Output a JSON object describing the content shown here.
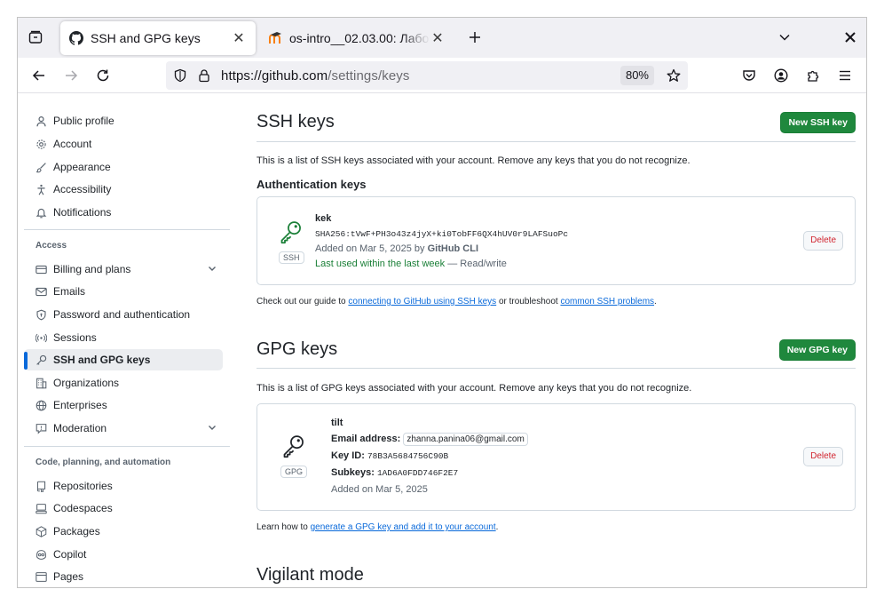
{
  "browser": {
    "tabs": [
      {
        "title": "SSH and GPG keys",
        "favicon": "github-icon",
        "active": true
      },
      {
        "title": "os-intro__02.03.00: Лабо",
        "favicon": "moodle-icon",
        "active": false
      }
    ],
    "url_host": "https://github.com",
    "url_path": "/settings/keys",
    "zoom": "80%"
  },
  "sidebar": {
    "items_top": [
      {
        "label": "Public profile",
        "icon": "person-icon"
      },
      {
        "label": "Account",
        "icon": "gear-icon"
      },
      {
        "label": "Appearance",
        "icon": "paintbrush-icon"
      },
      {
        "label": "Accessibility",
        "icon": "accessibility-icon"
      },
      {
        "label": "Notifications",
        "icon": "bell-icon"
      }
    ],
    "access_heading": "Access",
    "items_access": [
      {
        "label": "Billing and plans",
        "icon": "credit-card-icon"
      },
      {
        "label": "Emails",
        "icon": "mail-icon"
      },
      {
        "label": "Password and authentication",
        "icon": "shield-lock-icon"
      },
      {
        "label": "Sessions",
        "icon": "broadcast-icon"
      },
      {
        "label": "SSH and GPG keys",
        "icon": "key-icon"
      },
      {
        "label": "Organizations",
        "icon": "organization-icon"
      },
      {
        "label": "Enterprises",
        "icon": "globe-icon"
      },
      {
        "label": "Moderation",
        "icon": "report-icon"
      }
    ],
    "code_heading": "Code, planning, and automation",
    "items_code": [
      {
        "label": "Repositories",
        "icon": "repo-icon"
      },
      {
        "label": "Codespaces",
        "icon": "codespaces-icon"
      },
      {
        "label": "Packages",
        "icon": "package-icon"
      },
      {
        "label": "Copilot",
        "icon": "copilot-icon"
      },
      {
        "label": "Pages",
        "icon": "browser-icon"
      }
    ]
  },
  "ssh": {
    "title": "SSH keys",
    "new_button": "New SSH key",
    "description": "This is a list of SSH keys associated with your account. Remove any keys that you do not recognize.",
    "auth_heading": "Authentication keys",
    "key": {
      "badge": "SSH",
      "name": "kek",
      "fingerprint": "SHA256:tVwF+PH3o43z4jyX+ki0TobFF6QX4hUV0r9LAFSuoPc",
      "added_prefix": "Added on Mar 5, 2025 by",
      "added_by": "GitHub CLI",
      "last_used": "Last used within the last week",
      "access": "— Read/write",
      "delete": "Delete"
    },
    "guide_prefix": "Check out our guide to",
    "guide_link": "connecting to GitHub using SSH keys",
    "guide_middle": "or troubleshoot",
    "guide_link2": "common SSH problems",
    "guide_suffix": "."
  },
  "gpg": {
    "title": "GPG keys",
    "new_button": "New GPG key",
    "description": "This is a list of GPG keys associated with your account. Remove any keys that you do not recognize.",
    "key": {
      "badge": "GPG",
      "name": "tilt",
      "email_label": "Email address:",
      "email": "zhanna.panina06@gmail.com",
      "keyid_label": "Key ID:",
      "keyid": "78B3A5684756C90B",
      "subkeys_label": "Subkeys:",
      "subkeys": "1AD6A0FDD746F2E7",
      "added": "Added on Mar 5, 2025",
      "delete": "Delete"
    },
    "learn_prefix": "Learn how to",
    "learn_link": "generate a GPG key and add it to your account",
    "learn_suffix": "."
  },
  "vigilant": {
    "title": "Vigilant mode"
  }
}
